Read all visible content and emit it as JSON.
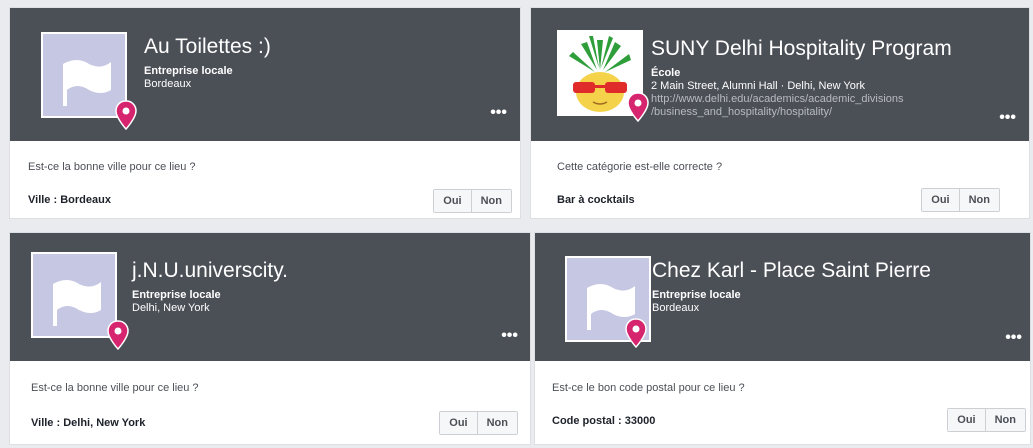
{
  "cards": [
    {
      "title": "Au Toilettes :)",
      "category": "Entreprise locale",
      "location": "Bordeaux",
      "question": "Est-ce la bonne ville pour ce lieu ?",
      "answer": "Ville : Bordeaux",
      "yes_label": "Oui",
      "no_label": "Non",
      "more_label": "•••"
    },
    {
      "title": "SUNY Delhi Hospitality Program",
      "category": "École",
      "address": "2 Main Street, Alumni Hall · Delhi, New York",
      "url_line1": "http://www.delhi.edu/academics/academic_divisions",
      "url_line2": "/business_and_hospitality/hospitality/",
      "question": "Cette catégorie est-elle correcte ?",
      "answer": "Bar à cocktails",
      "yes_label": "Oui",
      "no_label": "Non",
      "more_label": "•••"
    },
    {
      "title": "j.N.U.universcity.",
      "category": "Entreprise locale",
      "location": "Delhi, New York",
      "question": "Est-ce la bonne ville pour ce lieu ?",
      "answer": "Ville : Delhi, New York",
      "yes_label": "Oui",
      "no_label": "Non",
      "more_label": "•••"
    },
    {
      "title": "Chez Karl - Place Saint Pierre",
      "category": "Entreprise locale",
      "location": "Bordeaux",
      "question": "Est-ce le bon code postal pour ce lieu ?",
      "answer": "Code postal : 33000",
      "yes_label": "Oui",
      "no_label": "Non",
      "more_label": "•••"
    }
  ],
  "colors": {
    "header": "#4b4f56",
    "thumb": "#c5c7e3",
    "pin": "#d6246e"
  }
}
